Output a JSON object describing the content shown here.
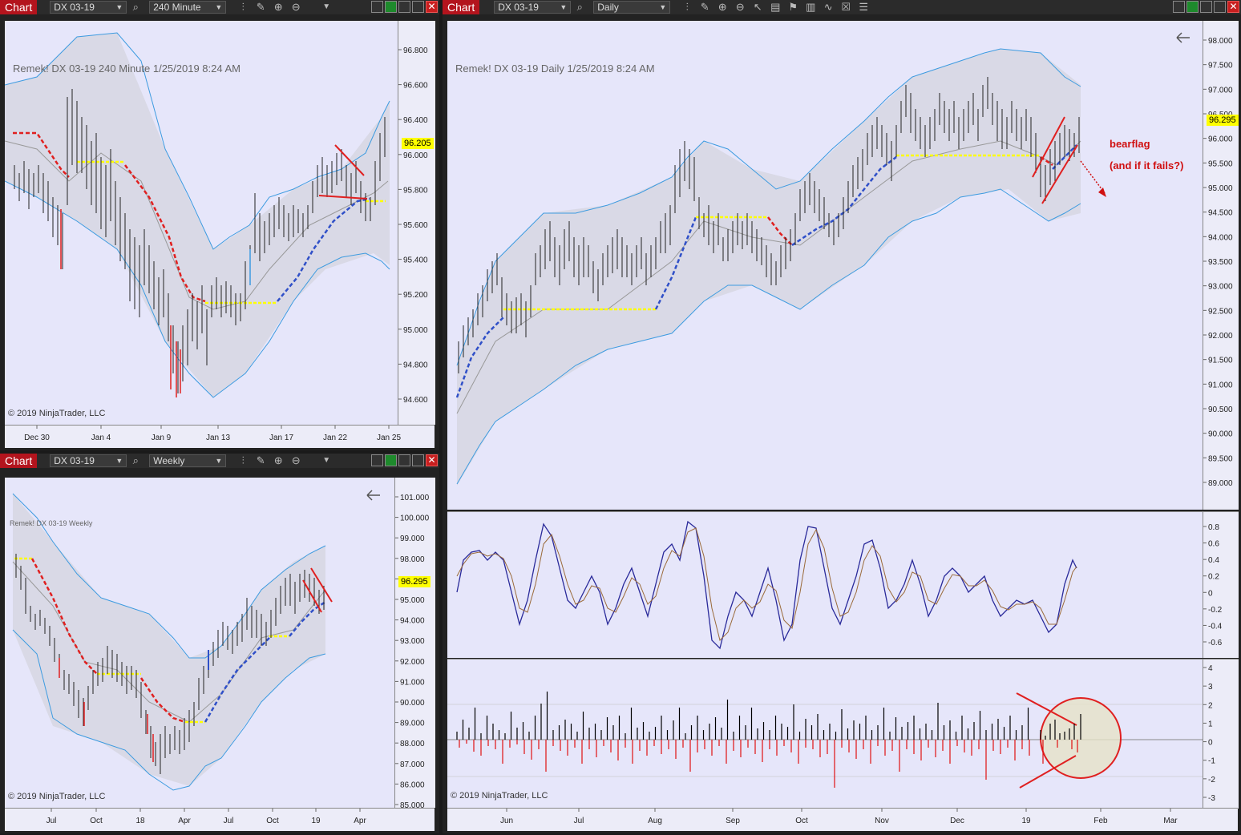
{
  "colors": {
    "plot_bg": "#e6e6fa",
    "band_fill": "#d9d9e6",
    "band_line": "#3d9be0",
    "up_red": "#e02020",
    "down_blue": "#3050c8",
    "yellow": "#ffff00",
    "osc_blue": "#2a2a9a",
    "osc_brown": "#9a6a3a",
    "vol_pos": "#000000",
    "vol_neg": "#e01010",
    "annot": "#d01010"
  },
  "toolbar": {
    "chart_label": "Chart",
    "instrument": "DX 03-19"
  },
  "win240": {
    "interval": "240 Minute",
    "title": "Remek!  DX 03-19  240 Minute  1/25/2019 8:24 AM",
    "copyright": "© 2019 NinjaTrader, LLC",
    "price_tag": "96.205",
    "yticks": [
      "96.800",
      "96.600",
      "96.400",
      "96.000",
      "95.800",
      "95.600",
      "95.400",
      "95.200",
      "95.000",
      "94.800",
      "94.600"
    ],
    "xticks": [
      "Dec 30",
      "Jan 4",
      "Jan 9",
      "Jan 13",
      "Jan 17",
      "Jan 22",
      "Jan 25"
    ]
  },
  "winWeekly": {
    "interval": "Weekly",
    "title": "Remek!  DX 03-19  Weekly",
    "copyright": "© 2019 NinjaTrader, LLC",
    "price_tag": "96.295",
    "yticks": [
      "101.000",
      "100.000",
      "99.000",
      "98.000",
      "97.000",
      "95.000",
      "94.000",
      "93.000",
      "92.000",
      "91.000",
      "90.000",
      "89.000",
      "88.000",
      "87.000",
      "86.000",
      "85.000"
    ],
    "xticks": [
      "Jul",
      "Oct",
      "18",
      "Apr",
      "Jul",
      "Oct",
      "19",
      "Apr"
    ]
  },
  "winDaily": {
    "interval": "Daily",
    "title": "Remek!  DX 03-19  Daily  1/25/2019 8:24 AM",
    "copyright": "© 2019 NinjaTrader, LLC",
    "price_tag": "96.295",
    "annotation1": "bearflag",
    "annotation2": "(and if it fails?)",
    "yticks": [
      "98.000",
      "97.500",
      "97.000",
      "96.500",
      "96.000",
      "95.500",
      "95.000",
      "94.500",
      "94.000",
      "93.500",
      "93.000",
      "92.500",
      "92.000",
      "91.500",
      "91.000",
      "90.500",
      "90.000",
      "89.500",
      "89.000"
    ],
    "osc_ticks": [
      "0.8",
      "0.6",
      "0.4",
      "0.2",
      "0",
      "-0.2",
      "-0.4",
      "-0.6"
    ],
    "vol_ticks": [
      "4",
      "3",
      "2",
      "1",
      "0",
      "-1",
      "-2",
      "-3"
    ],
    "xticks": [
      "Jun",
      "Jul",
      "Aug",
      "Sep",
      "Oct",
      "Nov",
      "Dec",
      "19",
      "Feb",
      "Mar"
    ]
  }
}
